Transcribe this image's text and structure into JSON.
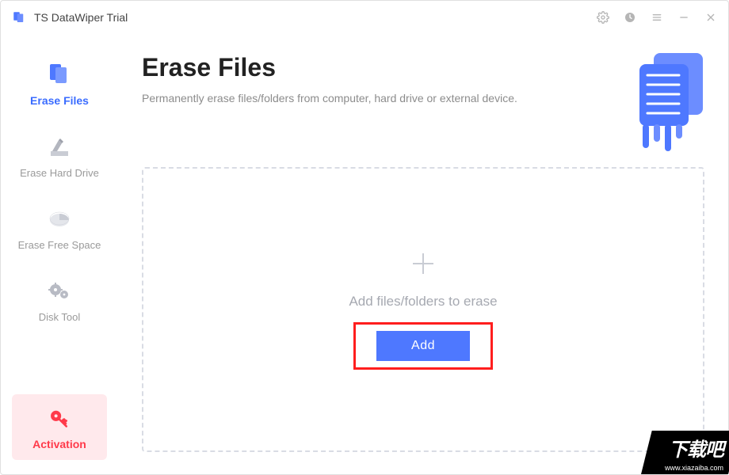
{
  "app": {
    "title": "TS DataWiper Trial"
  },
  "sidebar": {
    "items": [
      {
        "label": "Erase Files"
      },
      {
        "label": "Erase Hard Drive"
      },
      {
        "label": "Erase Free Space"
      },
      {
        "label": "Disk Tool"
      }
    ],
    "activation_label": "Activation"
  },
  "main": {
    "title": "Erase Files",
    "subtitle": "Permanently erase files/folders from computer, hard drive or external device.",
    "dropzone_label": "Add files/folders to erase",
    "add_button": "Add"
  },
  "watermark": {
    "line1": "下载吧",
    "line2": "www.xiazaiba.com"
  },
  "colors": {
    "accent": "#4e78ff",
    "danger": "#ff3a4a",
    "highlight_border": "#ff1e1e"
  }
}
